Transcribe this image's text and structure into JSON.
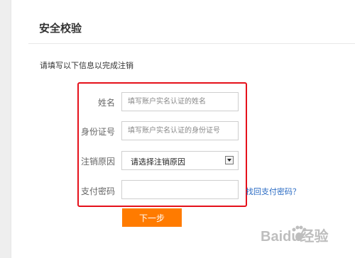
{
  "page": {
    "title": "安全校验",
    "instruction": "请填写以下信息以完成注销"
  },
  "form": {
    "name": {
      "label": "姓名",
      "placeholder": "填写账户实名认证的姓名"
    },
    "id_number": {
      "label": "身份证号",
      "placeholder": "填写账户实名认证的身份证号"
    },
    "reason": {
      "label": "注销原因",
      "selected": "请选择注销原因"
    },
    "password": {
      "label": "支付密码",
      "value": ""
    },
    "retrieve_link": "找回支付密码？",
    "next_button": "下一步"
  },
  "colors": {
    "highlight_box": "#e5101a",
    "primary_button": "#ff7b00",
    "link": "#2b6cc4"
  },
  "watermark": {
    "text": "Baidu经验",
    "icon": "paw-icon"
  }
}
